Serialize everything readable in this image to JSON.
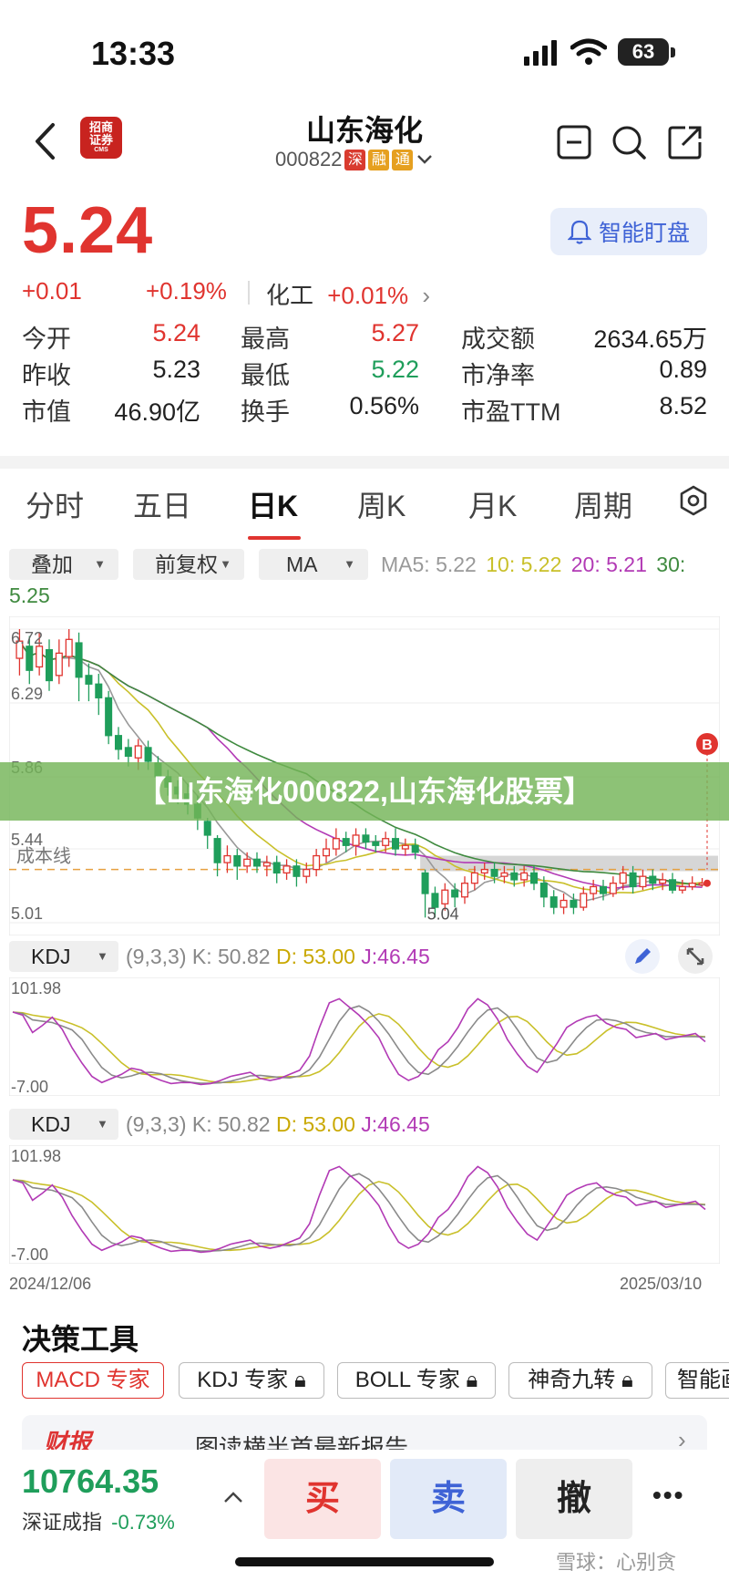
{
  "status": {
    "time": "13:33",
    "battery": "63"
  },
  "header": {
    "back_icon": "chevron-left",
    "logo_text_1": "招商",
    "logo_text_2": "证券",
    "logo_text_3": "CMS",
    "stock_name": "山东海化",
    "stock_code": "000822",
    "tags": [
      "深",
      "融",
      "通"
    ]
  },
  "quote": {
    "price": "5.24",
    "change": "+0.01",
    "change_pct": "+0.19%",
    "sector_name": "化工",
    "sector_change": "+0.01%",
    "alert_label": "智能盯盘"
  },
  "stats": [
    [
      {
        "label": "今开",
        "value": "5.24",
        "color": "red"
      },
      {
        "label": "最高",
        "value": "5.27",
        "color": "red"
      },
      {
        "label": "成交额",
        "value": "2634.65万",
        "color": "dark"
      }
    ],
    [
      {
        "label": "昨收",
        "value": "5.23",
        "color": "dark"
      },
      {
        "label": "最低",
        "value": "5.22",
        "color": "green"
      },
      {
        "label": "市净率",
        "value": "0.89",
        "color": "dark"
      }
    ],
    [
      {
        "label": "市值",
        "value": "46.90亿",
        "color": "dark"
      },
      {
        "label": "换手",
        "value": "0.56%",
        "color": "dark"
      },
      {
        "label": "市盈TTM",
        "value": "8.52",
        "color": "dark"
      }
    ]
  ],
  "tabs": [
    "分时",
    "五日",
    "日K",
    "周K",
    "月K",
    "周期"
  ],
  "active_tab": "日K",
  "toolbar": {
    "overlay": "叠加",
    "adjust": "前复权",
    "indicator": "MA"
  },
  "ma_legend": {
    "ma5": "MA5: 5.22",
    "ma10": "10: 5.22",
    "ma20": "20: 5.21",
    "ma30": "30:",
    "ma30_value": "5.25"
  },
  "ma_colors": {
    "ma5": "#999999",
    "ma10": "#c9c02a",
    "ma20": "#b23ab5",
    "ma30": "#3f8a3f"
  },
  "chart_data": {
    "type": "candlestick",
    "y_axis_labels": [
      "6.72",
      "6.29",
      "5.86",
      "5.44",
      "5.01"
    ],
    "ylim": [
      5.01,
      6.72
    ],
    "cost_line_label": "成本线",
    "cost_line_value": 5.32,
    "low_marker": "5.04",
    "high_marker_label": "B",
    "x_start": "2024/12/06",
    "x_end": "2025/03/10",
    "candles": [
      {
        "o": 6.55,
        "c": 6.65,
        "h": 6.72,
        "l": 6.45
      },
      {
        "o": 6.62,
        "c": 6.48,
        "h": 6.68,
        "l": 6.4
      },
      {
        "o": 6.5,
        "c": 6.62,
        "h": 6.7,
        "l": 6.45
      },
      {
        "o": 6.6,
        "c": 6.42,
        "h": 6.66,
        "l": 6.36
      },
      {
        "o": 6.45,
        "c": 6.58,
        "h": 6.66,
        "l": 6.4
      },
      {
        "o": 6.56,
        "c": 6.66,
        "h": 6.72,
        "l": 6.5
      },
      {
        "o": 6.64,
        "c": 6.44,
        "h": 6.7,
        "l": 6.3
      },
      {
        "o": 6.45,
        "c": 6.4,
        "h": 6.52,
        "l": 6.3
      },
      {
        "o": 6.4,
        "c": 6.32,
        "h": 6.46,
        "l": 6.22
      },
      {
        "o": 6.32,
        "c": 6.1,
        "h": 6.36,
        "l": 6.05
      },
      {
        "o": 6.1,
        "c": 6.02,
        "h": 6.15,
        "l": 5.96
      },
      {
        "o": 6.03,
        "c": 5.98,
        "h": 6.08,
        "l": 5.92
      },
      {
        "o": 5.97,
        "c": 6.04,
        "h": 6.08,
        "l": 5.9
      },
      {
        "o": 6.03,
        "c": 5.95,
        "h": 6.07,
        "l": 5.9
      },
      {
        "o": 5.94,
        "c": 5.86,
        "h": 5.98,
        "l": 5.8
      },
      {
        "o": 5.86,
        "c": 5.8,
        "h": 5.9,
        "l": 5.75
      },
      {
        "o": 5.8,
        "c": 5.76,
        "h": 5.84,
        "l": 5.7
      },
      {
        "o": 5.76,
        "c": 5.7,
        "h": 5.82,
        "l": 5.64
      },
      {
        "o": 5.7,
        "c": 5.62,
        "h": 5.75,
        "l": 5.55
      },
      {
        "o": 5.6,
        "c": 5.52,
        "h": 5.62,
        "l": 5.44
      },
      {
        "o": 5.5,
        "c": 5.36,
        "h": 5.52,
        "l": 5.28
      },
      {
        "o": 5.36,
        "c": 5.4,
        "h": 5.46,
        "l": 5.3
      },
      {
        "o": 5.4,
        "c": 5.34,
        "h": 5.44,
        "l": 5.26
      },
      {
        "o": 5.34,
        "c": 5.38,
        "h": 5.42,
        "l": 5.3
      },
      {
        "o": 5.38,
        "c": 5.34,
        "h": 5.42,
        "l": 5.3
      },
      {
        "o": 5.34,
        "c": 5.36,
        "h": 5.4,
        "l": 5.28
      },
      {
        "o": 5.36,
        "c": 5.3,
        "h": 5.4,
        "l": 5.24
      },
      {
        "o": 5.3,
        "c": 5.34,
        "h": 5.38,
        "l": 5.26
      },
      {
        "o": 5.34,
        "c": 5.28,
        "h": 5.38,
        "l": 5.22
      },
      {
        "o": 5.28,
        "c": 5.32,
        "h": 5.36,
        "l": 5.24
      },
      {
        "o": 5.32,
        "c": 5.4,
        "h": 5.44,
        "l": 5.28
      },
      {
        "o": 5.4,
        "c": 5.44,
        "h": 5.5,
        "l": 5.36
      },
      {
        "o": 5.44,
        "c": 5.5,
        "h": 5.56,
        "l": 5.4
      },
      {
        "o": 5.5,
        "c": 5.46,
        "h": 5.54,
        "l": 5.42
      },
      {
        "o": 5.46,
        "c": 5.52,
        "h": 5.56,
        "l": 5.4
      },
      {
        "o": 5.52,
        "c": 5.48,
        "h": 5.56,
        "l": 5.44
      },
      {
        "o": 5.48,
        "c": 5.46,
        "h": 5.52,
        "l": 5.42
      },
      {
        "o": 5.46,
        "c": 5.5,
        "h": 5.54,
        "l": 5.42
      },
      {
        "o": 5.5,
        "c": 5.44,
        "h": 5.56,
        "l": 5.4
      },
      {
        "o": 5.44,
        "c": 5.46,
        "h": 5.5,
        "l": 5.4
      },
      {
        "o": 5.46,
        "c": 5.42,
        "h": 5.5,
        "l": 5.38
      },
      {
        "o": 5.3,
        "c": 5.18,
        "h": 5.32,
        "l": 5.04
      },
      {
        "o": 5.18,
        "c": 5.1,
        "h": 5.22,
        "l": 5.04
      },
      {
        "o": 5.12,
        "c": 5.2,
        "h": 5.24,
        "l": 5.08
      },
      {
        "o": 5.2,
        "c": 5.16,
        "h": 5.24,
        "l": 5.1
      },
      {
        "o": 5.16,
        "c": 5.24,
        "h": 5.28,
        "l": 5.12
      },
      {
        "o": 5.24,
        "c": 5.3,
        "h": 5.34,
        "l": 5.2
      },
      {
        "o": 5.3,
        "c": 5.32,
        "h": 5.36,
        "l": 5.26
      },
      {
        "o": 5.32,
        "c": 5.28,
        "h": 5.36,
        "l": 5.24
      },
      {
        "o": 5.28,
        "c": 5.3,
        "h": 5.34,
        "l": 5.24
      },
      {
        "o": 5.3,
        "c": 5.26,
        "h": 5.34,
        "l": 5.22
      },
      {
        "o": 5.26,
        "c": 5.3,
        "h": 5.34,
        "l": 5.22
      },
      {
        "o": 5.3,
        "c": 5.24,
        "h": 5.34,
        "l": 5.2
      },
      {
        "o": 5.24,
        "c": 5.16,
        "h": 5.28,
        "l": 5.1
      },
      {
        "o": 5.16,
        "c": 5.1,
        "h": 5.2,
        "l": 5.06
      },
      {
        "o": 5.1,
        "c": 5.14,
        "h": 5.18,
        "l": 5.06
      },
      {
        "o": 5.14,
        "c": 5.1,
        "h": 5.18,
        "l": 5.06
      },
      {
        "o": 5.1,
        "c": 5.18,
        "h": 5.22,
        "l": 5.08
      },
      {
        "o": 5.18,
        "c": 5.22,
        "h": 5.26,
        "l": 5.14
      },
      {
        "o": 5.22,
        "c": 5.18,
        "h": 5.26,
        "l": 5.14
      },
      {
        "o": 5.18,
        "c": 5.24,
        "h": 5.28,
        "l": 5.16
      },
      {
        "o": 5.24,
        "c": 5.3,
        "h": 5.34,
        "l": 5.2
      },
      {
        "o": 5.3,
        "c": 5.22,
        "h": 5.34,
        "l": 5.18
      },
      {
        "o": 5.22,
        "c": 5.28,
        "h": 5.32,
        "l": 5.2
      },
      {
        "o": 5.28,
        "c": 5.24,
        "h": 5.32,
        "l": 5.2
      },
      {
        "o": 5.24,
        "c": 5.26,
        "h": 5.3,
        "l": 5.2
      },
      {
        "o": 5.26,
        "c": 5.2,
        "h": 5.3,
        "l": 5.18
      },
      {
        "o": 5.2,
        "c": 5.22,
        "h": 5.26,
        "l": 5.18
      },
      {
        "o": 5.22,
        "c": 5.24,
        "h": 5.28,
        "l": 5.2
      },
      {
        "o": 5.23,
        "c": 5.24,
        "h": 5.27,
        "l": 5.22
      }
    ]
  },
  "banner_text": "【山东海化000822,山东海化股票】",
  "kdj": {
    "name": "KDJ",
    "params": "(9,3,3)",
    "k": "K: 50.82",
    "d": "D: 53.00",
    "j": "J:46.45",
    "y_max": "101.98",
    "y_min": "-7.00",
    "k_color": "#8a8a8a",
    "d_color": "#c9c02a",
    "j_color": "#b23ab5"
  },
  "date_start": "2024/12/06",
  "date_end": "2025/03/10",
  "tools": {
    "title": "决策工具",
    "items": [
      "MACD 专家",
      "KDJ 专家",
      "BOLL 专家",
      "神奇九转",
      "智能画"
    ]
  },
  "news_peek": {
    "brand": "财报",
    "text": "图读横半首最新报告"
  },
  "bottom": {
    "index_value": "10764.35",
    "index_name": "深证成指",
    "index_change": "-0.73%",
    "buy": "买",
    "sell": "卖",
    "cancel": "撤",
    "more": "•••"
  },
  "watermark": "雪球：心别贪"
}
